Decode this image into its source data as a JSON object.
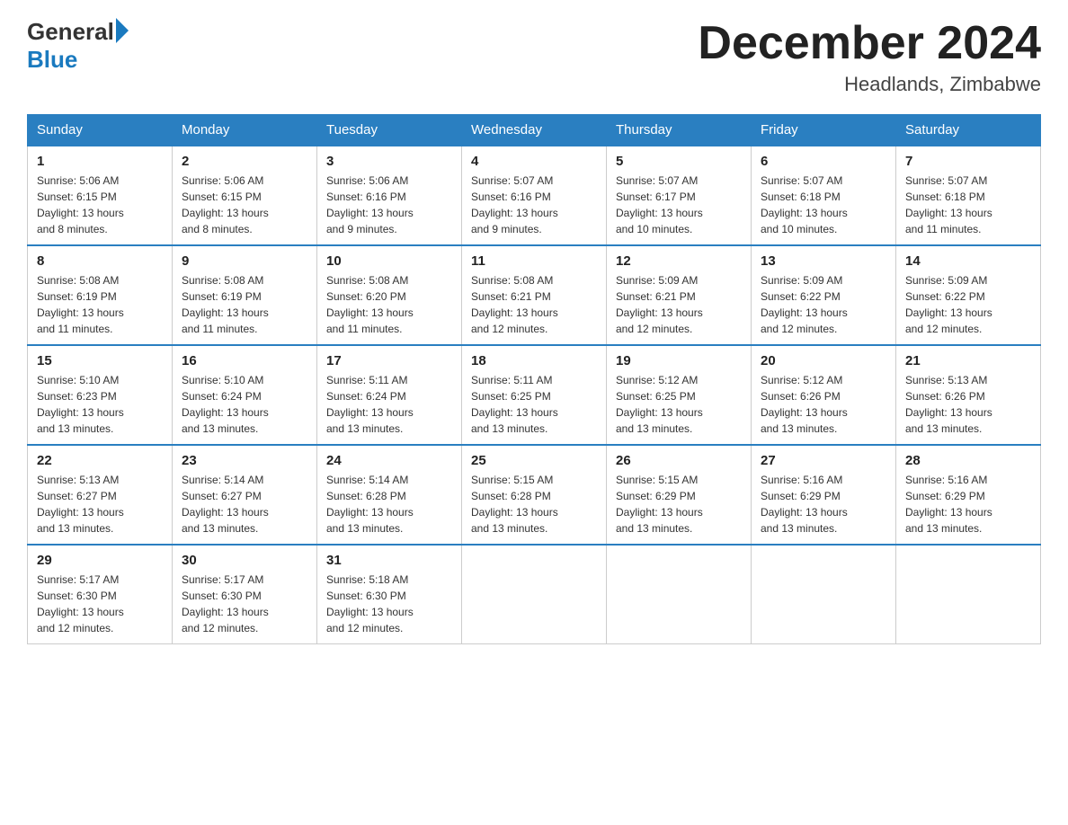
{
  "header": {
    "logo_general": "General",
    "logo_blue": "Blue",
    "month_year": "December 2024",
    "location": "Headlands, Zimbabwe"
  },
  "days_of_week": [
    "Sunday",
    "Monday",
    "Tuesday",
    "Wednesday",
    "Thursday",
    "Friday",
    "Saturday"
  ],
  "weeks": [
    [
      {
        "day": "1",
        "sunrise": "5:06 AM",
        "sunset": "6:15 PM",
        "daylight": "13 hours and 8 minutes."
      },
      {
        "day": "2",
        "sunrise": "5:06 AM",
        "sunset": "6:15 PM",
        "daylight": "13 hours and 8 minutes."
      },
      {
        "day": "3",
        "sunrise": "5:06 AM",
        "sunset": "6:16 PM",
        "daylight": "13 hours and 9 minutes."
      },
      {
        "day": "4",
        "sunrise": "5:07 AM",
        "sunset": "6:16 PM",
        "daylight": "13 hours and 9 minutes."
      },
      {
        "day": "5",
        "sunrise": "5:07 AM",
        "sunset": "6:17 PM",
        "daylight": "13 hours and 10 minutes."
      },
      {
        "day": "6",
        "sunrise": "5:07 AM",
        "sunset": "6:18 PM",
        "daylight": "13 hours and 10 minutes."
      },
      {
        "day": "7",
        "sunrise": "5:07 AM",
        "sunset": "6:18 PM",
        "daylight": "13 hours and 11 minutes."
      }
    ],
    [
      {
        "day": "8",
        "sunrise": "5:08 AM",
        "sunset": "6:19 PM",
        "daylight": "13 hours and 11 minutes."
      },
      {
        "day": "9",
        "sunrise": "5:08 AM",
        "sunset": "6:19 PM",
        "daylight": "13 hours and 11 minutes."
      },
      {
        "day": "10",
        "sunrise": "5:08 AM",
        "sunset": "6:20 PM",
        "daylight": "13 hours and 11 minutes."
      },
      {
        "day": "11",
        "sunrise": "5:08 AM",
        "sunset": "6:21 PM",
        "daylight": "13 hours and 12 minutes."
      },
      {
        "day": "12",
        "sunrise": "5:09 AM",
        "sunset": "6:21 PM",
        "daylight": "13 hours and 12 minutes."
      },
      {
        "day": "13",
        "sunrise": "5:09 AM",
        "sunset": "6:22 PM",
        "daylight": "13 hours and 12 minutes."
      },
      {
        "day": "14",
        "sunrise": "5:09 AM",
        "sunset": "6:22 PM",
        "daylight": "13 hours and 12 minutes."
      }
    ],
    [
      {
        "day": "15",
        "sunrise": "5:10 AM",
        "sunset": "6:23 PM",
        "daylight": "13 hours and 13 minutes."
      },
      {
        "day": "16",
        "sunrise": "5:10 AM",
        "sunset": "6:24 PM",
        "daylight": "13 hours and 13 minutes."
      },
      {
        "day": "17",
        "sunrise": "5:11 AM",
        "sunset": "6:24 PM",
        "daylight": "13 hours and 13 minutes."
      },
      {
        "day": "18",
        "sunrise": "5:11 AM",
        "sunset": "6:25 PM",
        "daylight": "13 hours and 13 minutes."
      },
      {
        "day": "19",
        "sunrise": "5:12 AM",
        "sunset": "6:25 PM",
        "daylight": "13 hours and 13 minutes."
      },
      {
        "day": "20",
        "sunrise": "5:12 AM",
        "sunset": "6:26 PM",
        "daylight": "13 hours and 13 minutes."
      },
      {
        "day": "21",
        "sunrise": "5:13 AM",
        "sunset": "6:26 PM",
        "daylight": "13 hours and 13 minutes."
      }
    ],
    [
      {
        "day": "22",
        "sunrise": "5:13 AM",
        "sunset": "6:27 PM",
        "daylight": "13 hours and 13 minutes."
      },
      {
        "day": "23",
        "sunrise": "5:14 AM",
        "sunset": "6:27 PM",
        "daylight": "13 hours and 13 minutes."
      },
      {
        "day": "24",
        "sunrise": "5:14 AM",
        "sunset": "6:28 PM",
        "daylight": "13 hours and 13 minutes."
      },
      {
        "day": "25",
        "sunrise": "5:15 AM",
        "sunset": "6:28 PM",
        "daylight": "13 hours and 13 minutes."
      },
      {
        "day": "26",
        "sunrise": "5:15 AM",
        "sunset": "6:29 PM",
        "daylight": "13 hours and 13 minutes."
      },
      {
        "day": "27",
        "sunrise": "5:16 AM",
        "sunset": "6:29 PM",
        "daylight": "13 hours and 13 minutes."
      },
      {
        "day": "28",
        "sunrise": "5:16 AM",
        "sunset": "6:29 PM",
        "daylight": "13 hours and 13 minutes."
      }
    ],
    [
      {
        "day": "29",
        "sunrise": "5:17 AM",
        "sunset": "6:30 PM",
        "daylight": "13 hours and 12 minutes."
      },
      {
        "day": "30",
        "sunrise": "5:17 AM",
        "sunset": "6:30 PM",
        "daylight": "13 hours and 12 minutes."
      },
      {
        "day": "31",
        "sunrise": "5:18 AM",
        "sunset": "6:30 PM",
        "daylight": "13 hours and 12 minutes."
      },
      null,
      null,
      null,
      null
    ]
  ]
}
